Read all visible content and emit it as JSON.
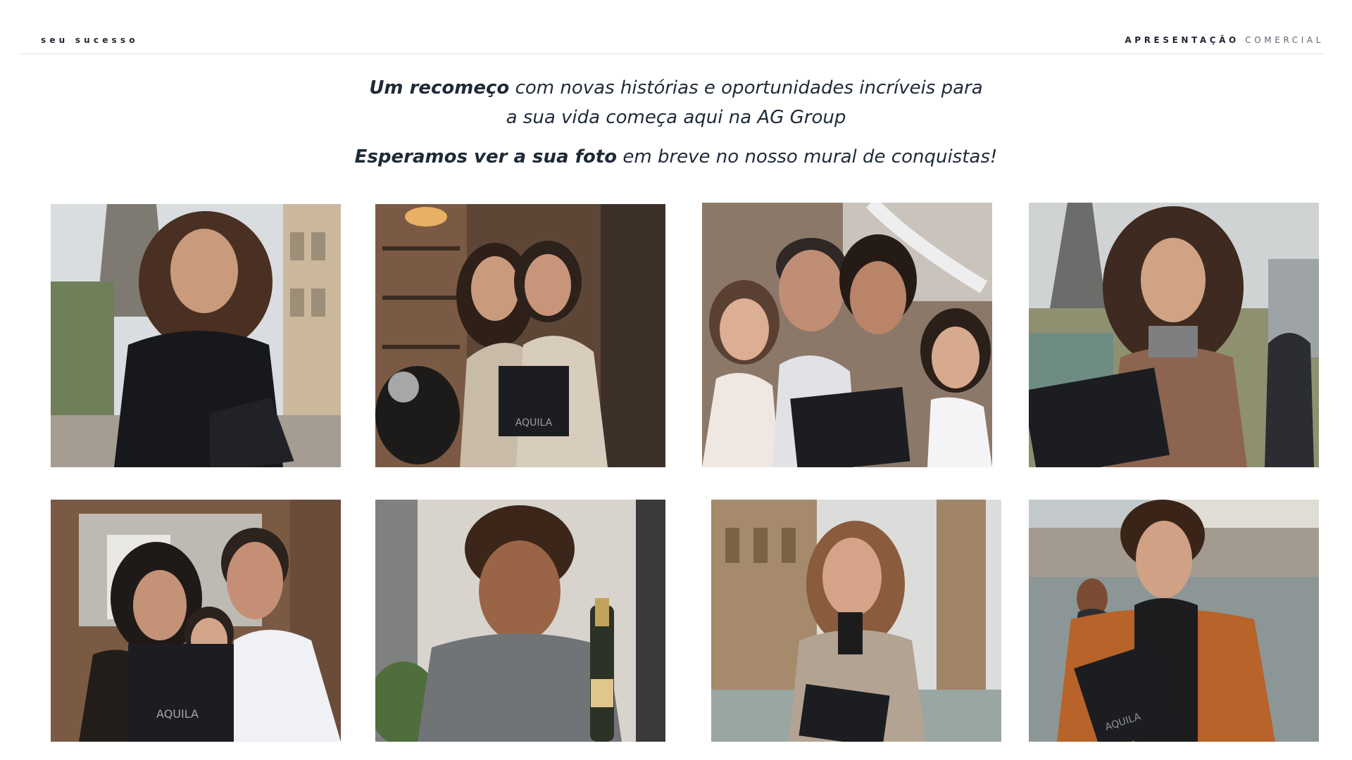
{
  "header": {
    "left_label": "seu sucesso",
    "right_label_bold": "APRESENTAÇÃO",
    "right_label_regular": "COMERCIAL"
  },
  "intro": {
    "line1_bold": "Um recomeço",
    "line1_rest": "com novas histórias e oportunidades incríveis para",
    "line2": "a sua vida começa aqui na AG Group",
    "line3_bold": "Esperamos ver a sua foto",
    "line3_rest": "em breve no nosso mural de conquistas!"
  },
  "gallery": {
    "photos": [
      {
        "scene": "woman-eiffel-tower",
        "folder_text": ""
      },
      {
        "scene": "couple-cafe-scooter",
        "folder_text": "AQUILA"
      },
      {
        "scene": "family-four",
        "folder_text": ""
      },
      {
        "scene": "woman-paris-park",
        "folder_text": ""
      },
      {
        "scene": "family-three",
        "folder_text": "AQUILA"
      },
      {
        "scene": "man-champagne",
        "folder_text": ""
      },
      {
        "scene": "woman-big-ben",
        "folder_text": ""
      },
      {
        "scene": "man-river",
        "folder_text": "AQUILA"
      }
    ]
  },
  "colors": {
    "text_dark": "#1e2733",
    "text_muted": "#5a6675",
    "divider": "#e3e5e8",
    "folder": "#1b1d21"
  }
}
